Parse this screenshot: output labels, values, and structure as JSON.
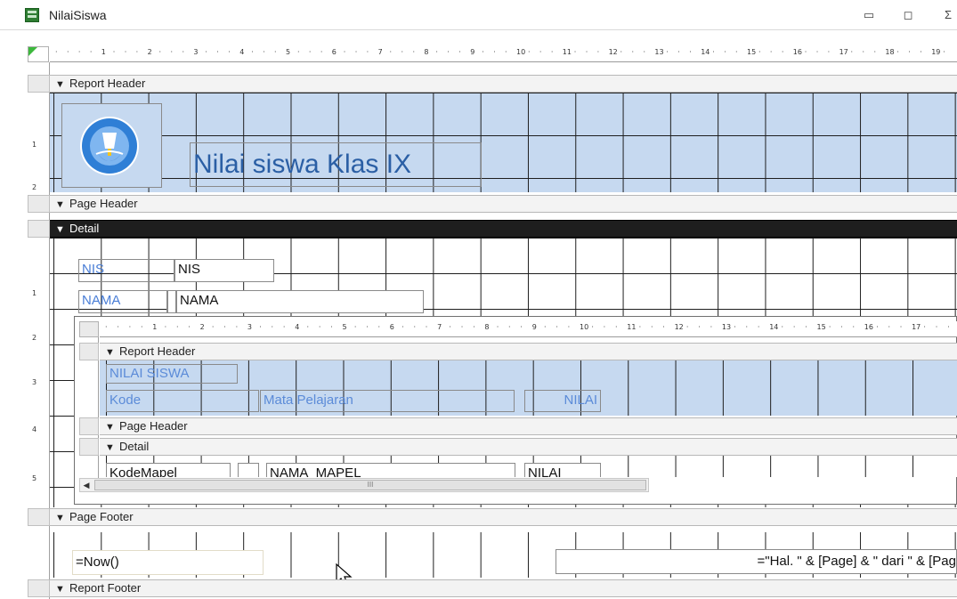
{
  "window": {
    "title": "NilaiSiswa",
    "minimize": "▭",
    "restore": "◻",
    "close": "Σ"
  },
  "ruler_top": [
    "1",
    "2",
    "3",
    "4",
    "5",
    "6",
    "7",
    "8",
    "9",
    "10",
    "11",
    "12",
    "13",
    "14",
    "15",
    "16",
    "17",
    "18",
    "19"
  ],
  "ruler_left": [
    "1",
    "2",
    "1",
    "2",
    "3",
    "4",
    "5"
  ],
  "sections": {
    "report_header": "Report Header",
    "page_header": "Page Header",
    "detail": "Detail",
    "page_footer": "Page Footer",
    "report_footer": "Report Footer"
  },
  "report_header": {
    "title": "Nilai siswa Klas IX",
    "logo": "tut-wuri-handayani-logo"
  },
  "detail": {
    "nis_label": "NIS",
    "nis_field": "NIS",
    "nama_label": "NAMA",
    "nama_field": "NAMA"
  },
  "subreport": {
    "ruler": [
      "1",
      "2",
      "3",
      "4",
      "5",
      "6",
      "7",
      "8",
      "9",
      "10",
      "11",
      "12",
      "13",
      "14",
      "15",
      "16",
      "17"
    ],
    "sections": {
      "report_header": "Report Header",
      "page_header": "Page Header",
      "detail": "Detail"
    },
    "header_title": "NILAI SISWA",
    "col_kode": "Kode",
    "col_mapel": "Mata Pelajaran",
    "col_nilai": "NILAI",
    "field_kode": "KodeMapel",
    "field_mapel": "NAMA_MAPEL",
    "field_nilai": "NILAI",
    "scroll_thumb": "III"
  },
  "page_footer": {
    "date_expr": "=Now()",
    "page_expr": "=\"Hal. \" & [Page] & \" dari \" & [Pag"
  },
  "colors": {
    "grid_blue": "#c6d9f0",
    "label_blue": "#4a7ed6",
    "detail_bar": "#1e1e1e"
  }
}
